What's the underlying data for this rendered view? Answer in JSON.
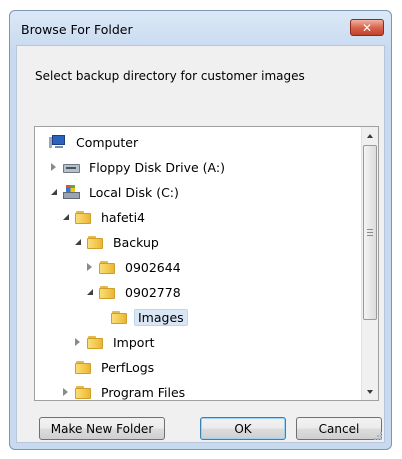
{
  "dialog": {
    "title": "Browse For Folder",
    "close_glyph": "✕",
    "prompt": "Select backup directory for customer images"
  },
  "tree": {
    "nodes": [
      {
        "label": "Computer",
        "icon": "computer-icon",
        "expander": "none"
      },
      {
        "label": "Floppy Disk Drive (A:)",
        "icon": "floppy-disk-icon",
        "expander": "collapsed"
      },
      {
        "label": "Local Disk (C:)",
        "icon": "local-disk-icon",
        "expander": "expanded"
      },
      {
        "label": "hafeti4",
        "icon": "folder-icon",
        "expander": "expanded"
      },
      {
        "label": "Backup",
        "icon": "folder-icon",
        "expander": "expanded"
      },
      {
        "label": "0902644",
        "icon": "folder-icon",
        "expander": "collapsed"
      },
      {
        "label": "0902778",
        "icon": "folder-icon",
        "expander": "expanded"
      },
      {
        "label": "Images",
        "icon": "folder-icon",
        "expander": "none",
        "selected": true
      },
      {
        "label": "Import",
        "icon": "folder-icon",
        "expander": "collapsed"
      },
      {
        "label": "PerfLogs",
        "icon": "folder-icon",
        "expander": "none"
      },
      {
        "label": "Program Files",
        "icon": "folder-icon",
        "expander": "collapsed"
      }
    ]
  },
  "buttons": {
    "make_new_folder": "Make New Folder",
    "ok": "OK",
    "cancel": "Cancel"
  },
  "colors": {
    "title_gradient": "#c8daf0",
    "close_button": "#c0412a",
    "selection": "#d9e6f5",
    "default_button_border": "#3c7fb1"
  }
}
